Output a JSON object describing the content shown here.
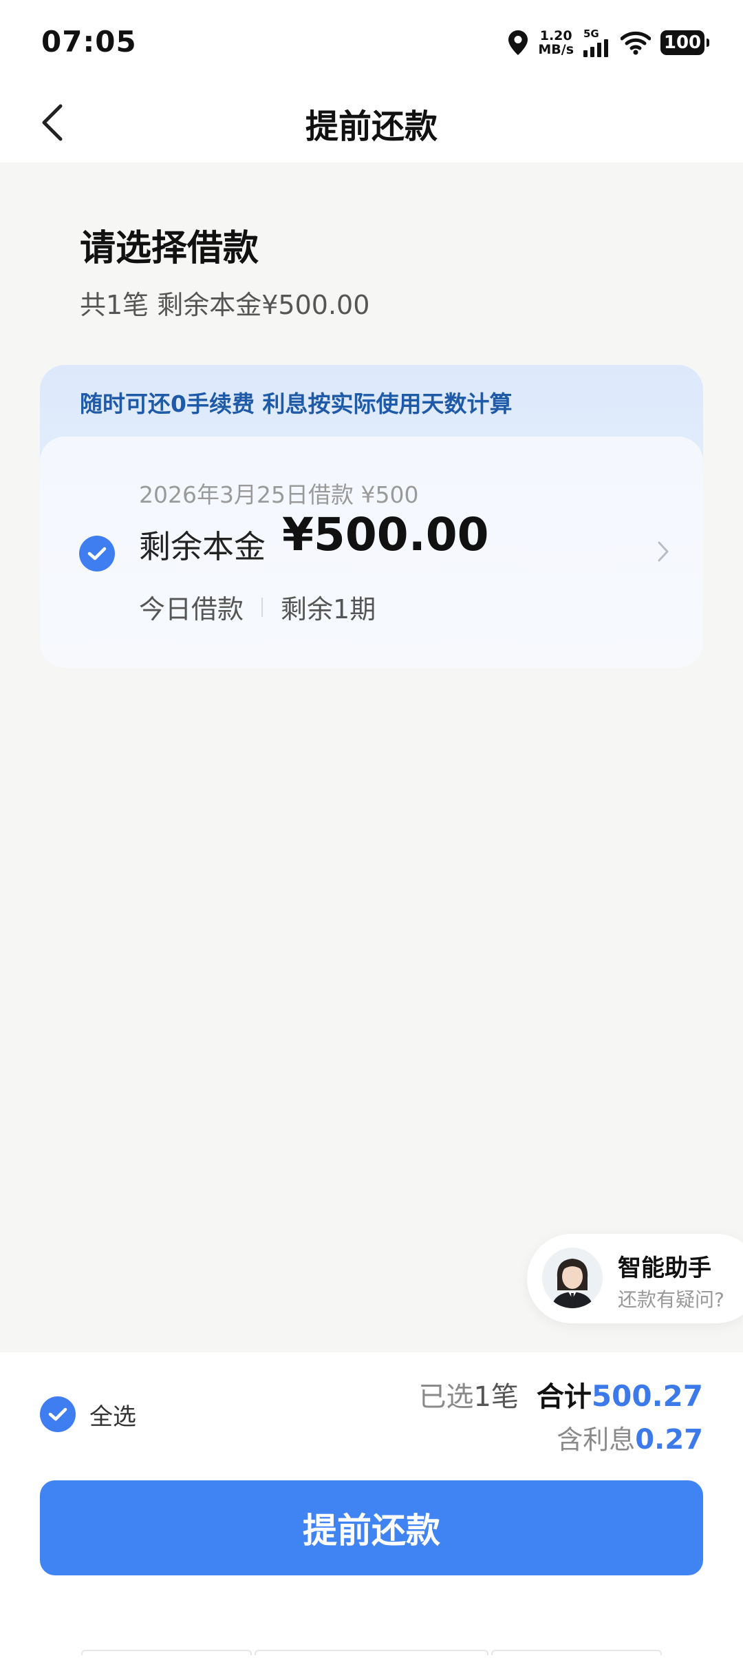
{
  "status_bar": {
    "time": "07:05",
    "net_speed_value": "1.20",
    "net_speed_unit": "MB/s",
    "network_type": "5G",
    "battery": "100",
    "icons": [
      "location-icon",
      "signal-icon",
      "wifi-icon",
      "battery-icon"
    ]
  },
  "nav": {
    "title": "提前还款",
    "back_icon": "chevron-left-icon"
  },
  "section": {
    "title": "请选择借款",
    "subtitle": "共1笔 剩余本金¥500.00"
  },
  "loan_card": {
    "banner": "随时可还0手续费 利息按实际使用天数计算",
    "loan_date": "2026年3月25日借款 ¥500",
    "principal_label": "剩余本金",
    "principal_amount": "¥500.00",
    "tag_left": "今日借款",
    "tag_right": "剩余1期",
    "selected": true
  },
  "assistant": {
    "title": "智能助手",
    "subtitle": "还款有疑问?"
  },
  "bottom": {
    "select_all_label": "全选",
    "selected_prefix": "已选",
    "selected_count": "1",
    "selected_unit": "笔",
    "total_label": "合计",
    "total_amount": "500.27",
    "interest_label": "含利息",
    "interest_amount": "0.27",
    "button_label": "提前还款"
  },
  "colors": {
    "accent": "#4083f2",
    "amount_blue": "#3b7ae8",
    "banner_text": "#1e5aa8",
    "page_bg": "#f6f6f5"
  }
}
